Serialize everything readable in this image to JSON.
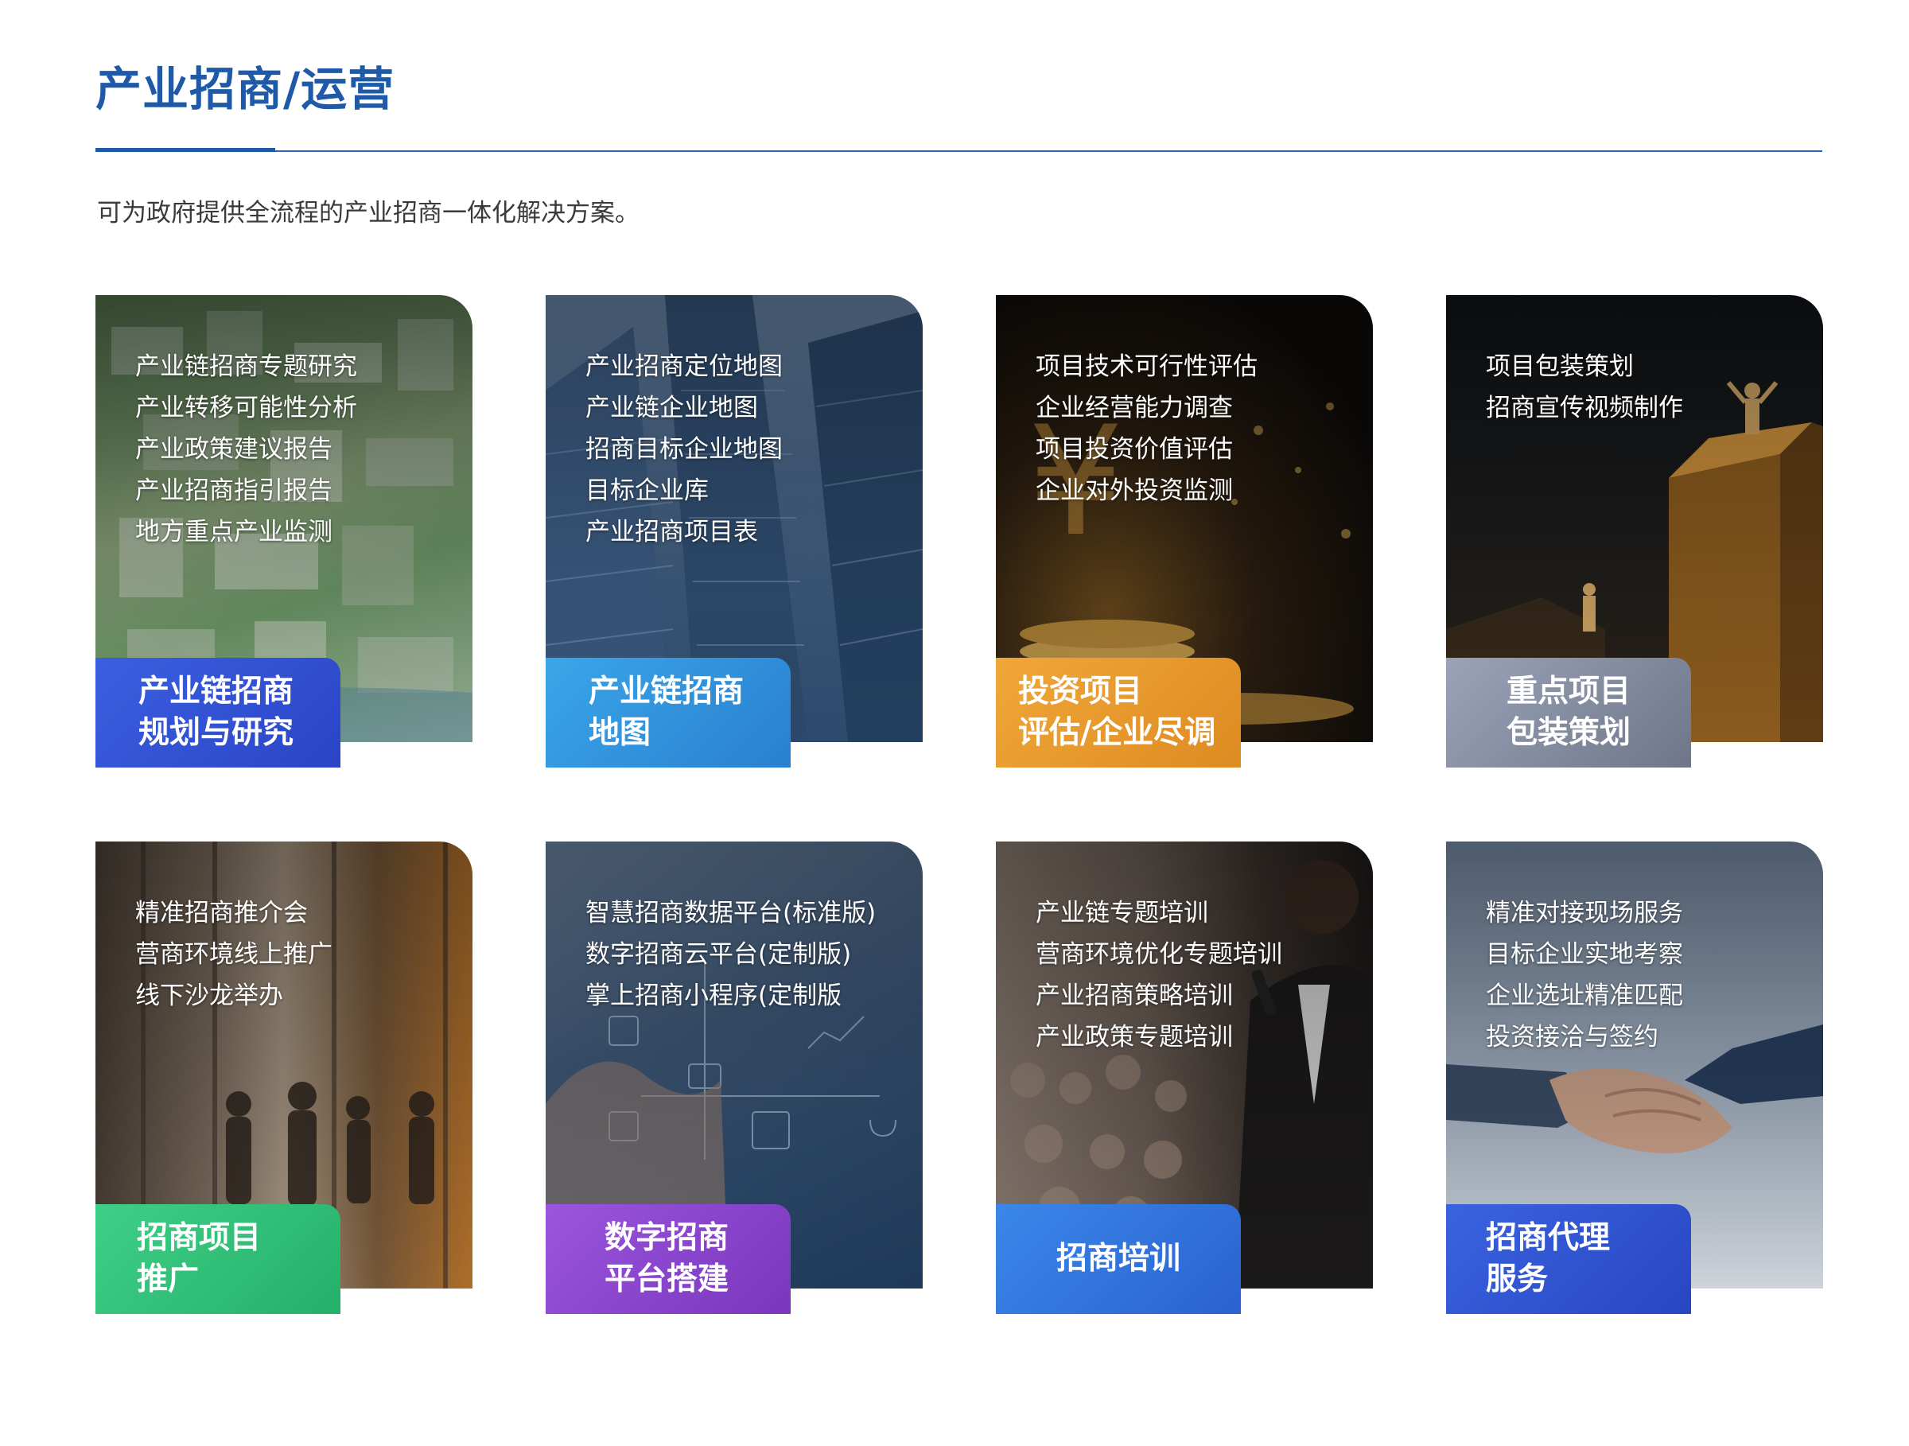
{
  "header": {
    "title": "产业招商/运营",
    "subtitle": "可为政府提供全流程的产业招商一体化解决方案。"
  },
  "colors": {
    "title": "#1e5aa8",
    "rule": "#2d63b8"
  },
  "cards": [
    {
      "label_line1": "产业链招商",
      "label_line2": "规划与研究",
      "label_color": "#3256d6",
      "image": "city-aerial-model",
      "items": [
        "产业链招商专题研究",
        "产业转移可能性分析",
        "产业政策建议报告",
        "产业招商指引报告",
        "地方重点产业监测"
      ]
    },
    {
      "label_line1": "产业链招商",
      "label_line2": "地图",
      "label_color": "#2a8fd8",
      "image": "glass-skyscrapers",
      "items": [
        "产业招商定位地图",
        "产业链企业地图",
        "招商目标企业地图",
        "目标企业库",
        "产业招商项目表"
      ]
    },
    {
      "label_line1": "投资项目",
      "label_line2": "评估/企业尽调",
      "label_color": "#e79a2c",
      "image": "gold-coins-yen",
      "items": [
        "项目技术可行性评估",
        "企业经营能力调查",
        "项目投资价值评估",
        "企业对外投资监测"
      ]
    },
    {
      "label_line1": "重点项目",
      "label_line2": "包装策划",
      "label_color": "#7d8496",
      "image": "golden-podium-figures",
      "items": [
        "项目包装策划",
        "招商宣传视频制作"
      ]
    },
    {
      "label_line1": "招商项目",
      "label_line2": "推广",
      "label_color": "#2fbf7a",
      "image": "silhouettes-window",
      "items": [
        "精准招商推介会",
        "营商环境线上推广",
        "线下沙龙举办"
      ]
    },
    {
      "label_line1": "数字招商",
      "label_line2": "平台搭建",
      "label_color": "#8a43cc",
      "image": "digital-interface",
      "items": [
        "智慧招商数据平台(标准版)",
        "数字招商云平台(定制版)",
        "掌上招商小程序(定制版"
      ]
    },
    {
      "label_line1": "招商培训",
      "label_line2": "",
      "label_color": "#2a6fd6",
      "image": "speaker-audience",
      "items": [
        "产业链专题培训",
        "营商环境优化专题培训",
        "产业招商策略培训",
        "产业政策专题培训"
      ]
    },
    {
      "label_line1": "招商代理",
      "label_line2": "服务",
      "label_color": "#2e56cf",
      "image": "handshake",
      "items": [
        "精准对接现场服务",
        "目标企业实地考察",
        "企业选址精准匹配",
        "投资接洽与签约"
      ]
    }
  ]
}
